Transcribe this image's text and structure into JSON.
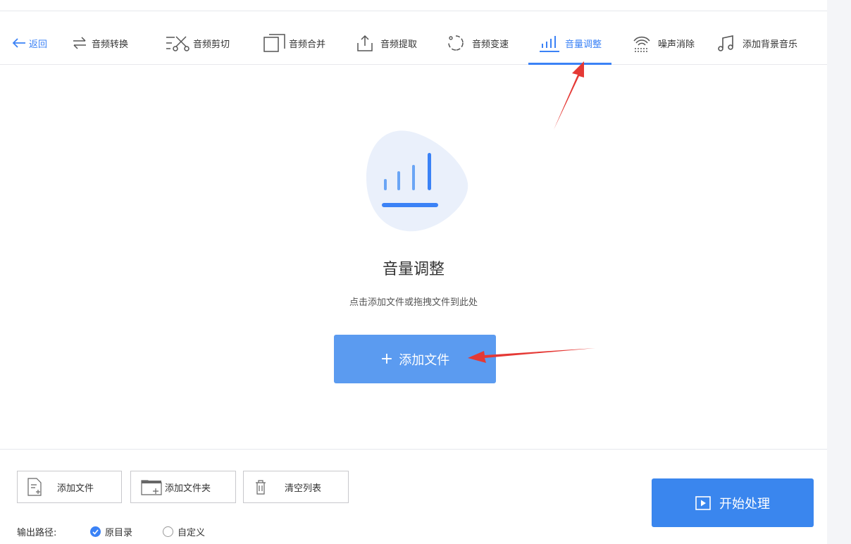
{
  "toolbar": {
    "back": "返回",
    "items": [
      {
        "label": "音频转换",
        "icon": "swap-arrows-icon"
      },
      {
        "label": "音频剪切",
        "icon": "scissors-icon"
      },
      {
        "label": "音频合并",
        "icon": "merge-icon"
      },
      {
        "label": "音频提取",
        "icon": "upload-tray-icon"
      },
      {
        "label": "音频变速",
        "icon": "speed-circle-icon"
      },
      {
        "label": "音量调整",
        "icon": "volume-bars-icon",
        "active": true
      },
      {
        "label": "噪声消除",
        "icon": "noise-wave-icon"
      },
      {
        "label": "添加背景音乐",
        "icon": "music-note-icon"
      }
    ]
  },
  "main": {
    "title": "音量调整",
    "subtitle": "点击添加文件或拖拽文件到此处",
    "add_button_plus": "+",
    "add_button_label": "添加文件"
  },
  "bottom": {
    "add_file": "添加文件",
    "add_folder": "添加文件夹",
    "clear_list": "清空列表",
    "output_label": "输出路径:",
    "option_original": "原目录",
    "option_custom": "自定义",
    "start": "开始处理"
  },
  "colors": {
    "accent": "#3b82f6",
    "button_blue": "#5b9bf0",
    "start_blue": "#3a86ee",
    "annotation_arrow": "#e53935"
  }
}
